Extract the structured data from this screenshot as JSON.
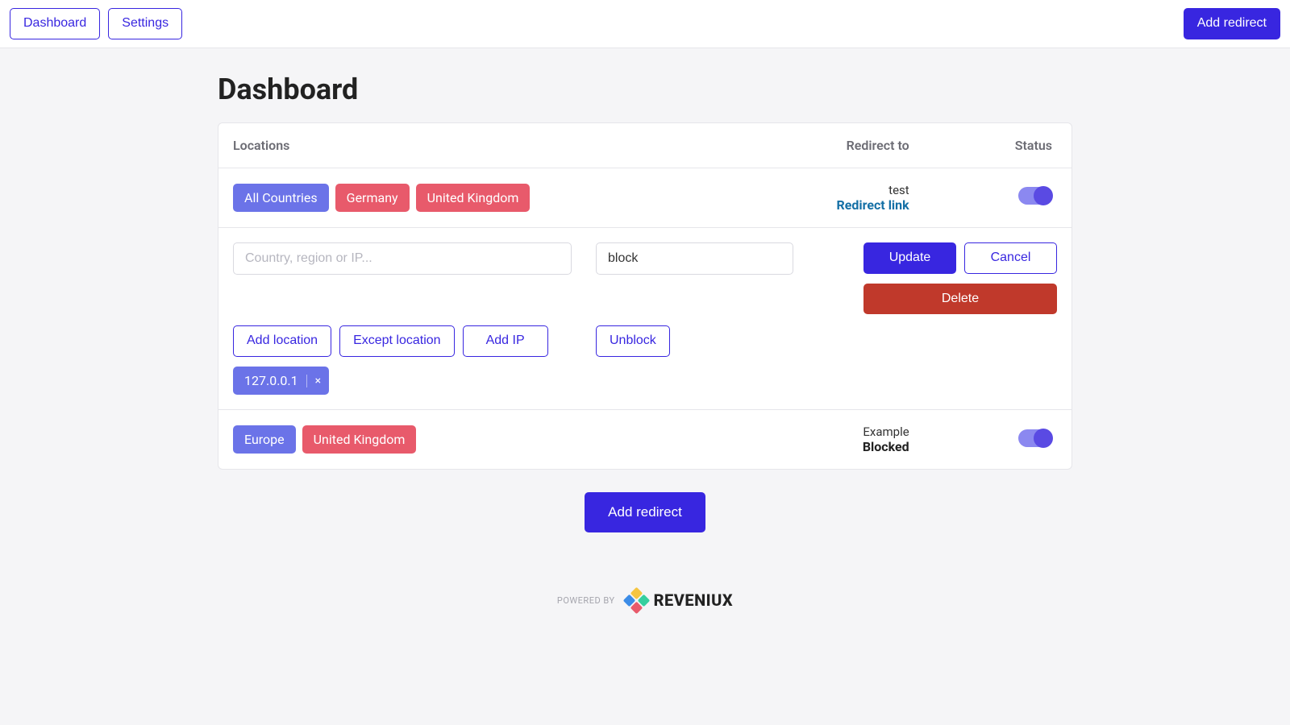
{
  "nav": {
    "dashboard": "Dashboard",
    "settings": "Settings",
    "add_redirect": "Add redirect"
  },
  "page": {
    "title": "Dashboard"
  },
  "table": {
    "headers": {
      "locations": "Locations",
      "redirect_to": "Redirect to",
      "status": "Status"
    },
    "rows": [
      {
        "tags": [
          {
            "label": "All Countries",
            "variant": "blue"
          },
          {
            "label": "Germany",
            "variant": "red"
          },
          {
            "label": "United Kingdom",
            "variant": "red"
          }
        ],
        "redirect_name": "test",
        "redirect_action_label": "Redirect link",
        "status_enabled": true,
        "blocked": false
      },
      {
        "tags": [
          {
            "label": "Europe",
            "variant": "blue"
          },
          {
            "label": "United Kingdom",
            "variant": "red"
          }
        ],
        "redirect_name": "Example",
        "redirect_action_label": "Blocked",
        "status_enabled": true,
        "blocked": true
      }
    ]
  },
  "editor": {
    "location_placeholder": "Country, region or IP...",
    "location_value": "",
    "redirect_value": "block",
    "add_location": "Add location",
    "except_location": "Except location",
    "add_ip": "Add IP",
    "unblock": "Unblock",
    "update": "Update",
    "cancel": "Cancel",
    "delete": "Delete",
    "chips": [
      {
        "label": "127.0.0.1"
      }
    ]
  },
  "bottom": {
    "add_redirect": "Add redirect"
  },
  "footer": {
    "powered_by": "POWERED BY",
    "brand": "REVENIUX"
  }
}
